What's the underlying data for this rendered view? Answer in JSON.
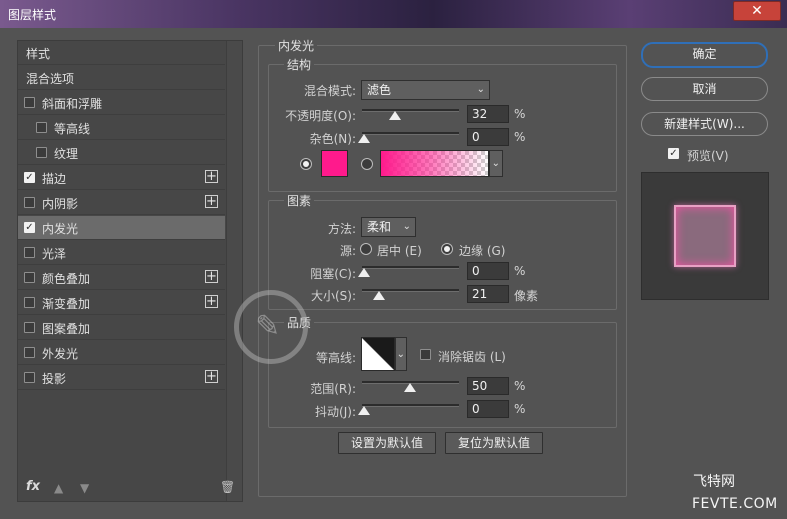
{
  "window": {
    "title": "图层样式",
    "close_label": "✕"
  },
  "style_list": {
    "items": [
      {
        "label": "样式",
        "checkbox": false,
        "checked": false,
        "plus": false,
        "selected": false,
        "indent": 0
      },
      {
        "label": "混合选项",
        "checkbox": false,
        "checked": false,
        "plus": false,
        "selected": false,
        "indent": 0
      },
      {
        "label": "斜面和浮雕",
        "checkbox": true,
        "checked": false,
        "plus": false,
        "selected": false,
        "indent": 0
      },
      {
        "label": "等高线",
        "checkbox": true,
        "checked": false,
        "plus": false,
        "selected": false,
        "indent": 1
      },
      {
        "label": "纹理",
        "checkbox": true,
        "checked": false,
        "plus": false,
        "selected": false,
        "indent": 1
      },
      {
        "label": "描边",
        "checkbox": true,
        "checked": true,
        "plus": true,
        "selected": false,
        "indent": 0
      },
      {
        "label": "内阴影",
        "checkbox": true,
        "checked": false,
        "plus": true,
        "selected": false,
        "indent": 0
      },
      {
        "label": "内发光",
        "checkbox": true,
        "checked": true,
        "plus": false,
        "selected": true,
        "indent": 0
      },
      {
        "label": "光泽",
        "checkbox": true,
        "checked": false,
        "plus": false,
        "selected": false,
        "indent": 0
      },
      {
        "label": "颜色叠加",
        "checkbox": true,
        "checked": false,
        "plus": true,
        "selected": false,
        "indent": 0
      },
      {
        "label": "渐变叠加",
        "checkbox": true,
        "checked": false,
        "plus": true,
        "selected": false,
        "indent": 0
      },
      {
        "label": "图案叠加",
        "checkbox": true,
        "checked": false,
        "plus": false,
        "selected": false,
        "indent": 0
      },
      {
        "label": "外发光",
        "checkbox": true,
        "checked": false,
        "plus": false,
        "selected": false,
        "indent": 0
      },
      {
        "label": "投影",
        "checkbox": true,
        "checked": false,
        "plus": true,
        "selected": false,
        "indent": 0
      }
    ],
    "fx_label": "fx",
    "up_icon": "▲",
    "down_icon": "▼",
    "trash_icon": "🗑"
  },
  "inner_glow": {
    "title": "内发光",
    "structure": {
      "title": "结构",
      "blend_mode_label": "混合模式:",
      "blend_mode_value": "滤色",
      "opacity_label": "不透明度(O):",
      "opacity_value": "32",
      "noise_label": "杂色(N):",
      "noise_value": "0",
      "percent": "%",
      "glow_color": "#ff1a8c"
    },
    "elements": {
      "title": "图素",
      "technique_label": "方法:",
      "technique_value": "柔和",
      "source_label": "源:",
      "source_center": "居中 (E)",
      "source_edge": "边缘 (G)",
      "choke_label": "阻塞(C):",
      "choke_value": "0",
      "size_label": "大小(S):",
      "size_value": "21",
      "size_unit": "像素",
      "percent": "%"
    },
    "quality": {
      "title": "品质",
      "contour_label": "等高线:",
      "antialias_label": "消除锯齿 (L)",
      "range_label": "范围(R):",
      "range_value": "50",
      "jitter_label": "抖动(J):",
      "jitter_value": "0",
      "percent": "%"
    },
    "make_default": "设置为默认值",
    "reset_default": "复位为默认值"
  },
  "right_panel": {
    "ok": "确定",
    "cancel": "取消",
    "new_style": "新建样式(W)...",
    "preview_label": "预览(V)",
    "preview_checked": true
  },
  "watermark": {
    "line1": "飞特网",
    "line2": "FEVTE.COM"
  }
}
